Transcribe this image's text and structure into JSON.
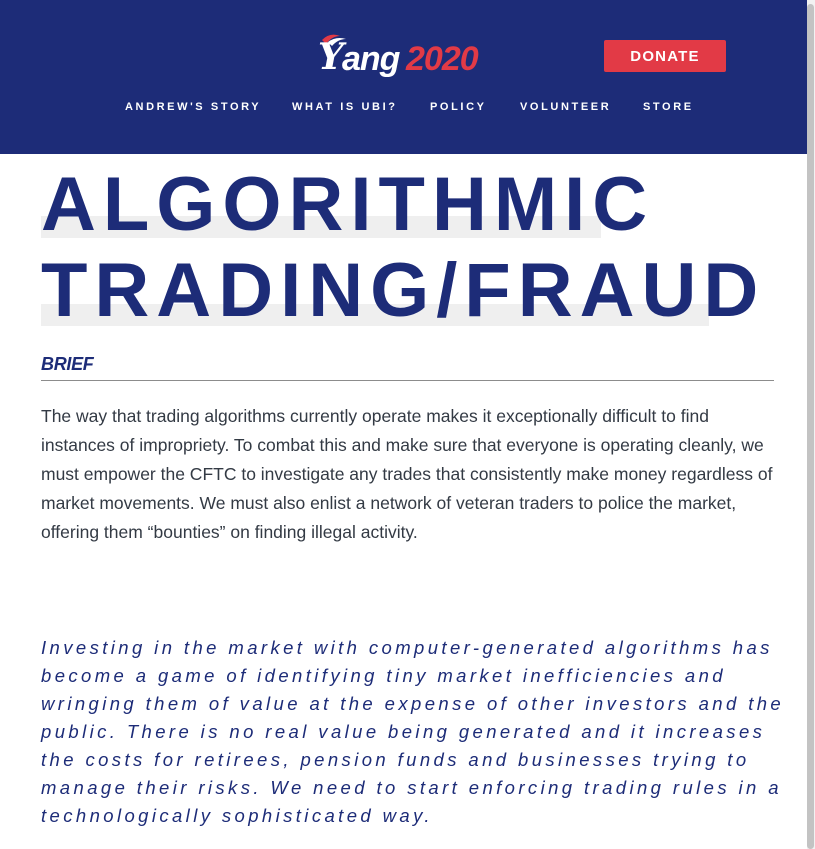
{
  "header": {
    "logo": {
      "first": "Y",
      "rest": "ang",
      "year": "2020"
    },
    "donate_label": "DONATE",
    "nav": [
      {
        "label": "ANDREW'S STORY"
      },
      {
        "label": "WHAT IS UBI?"
      },
      {
        "label": "POLICY"
      },
      {
        "label": "VOLUNTEER"
      },
      {
        "label": "STORE"
      }
    ]
  },
  "main": {
    "title_lines": [
      "ALGORITHMIC",
      "TRADING/FRAUD"
    ],
    "brief_label": "BRIEF",
    "brief_text": "The way that trading algorithms currently operate makes it exceptionally difficult to find instances of impropriety. To combat this and make sure that everyone is operating cleanly, we must empower the CFTC to investigate any trades that consistently make money regardless of market movements. We must also enlist a network of veteran traders to police the market, offering them “bounties” on finding illegal activity.",
    "quote": "Investing in the market with computer-generated algorithms has become a game of identifying tiny market inefficiencies and wringing them of value at the expense of other investors and the public. There is no real value being generated and it increases the costs for retirees, pension funds and businesses trying to manage their risks. We need to start enforcing trading rules in a technologically sophisticated way."
  },
  "colors": {
    "brand_navy": "#1d2c78",
    "brand_red": "#e23a46",
    "body_text": "#333a44"
  }
}
